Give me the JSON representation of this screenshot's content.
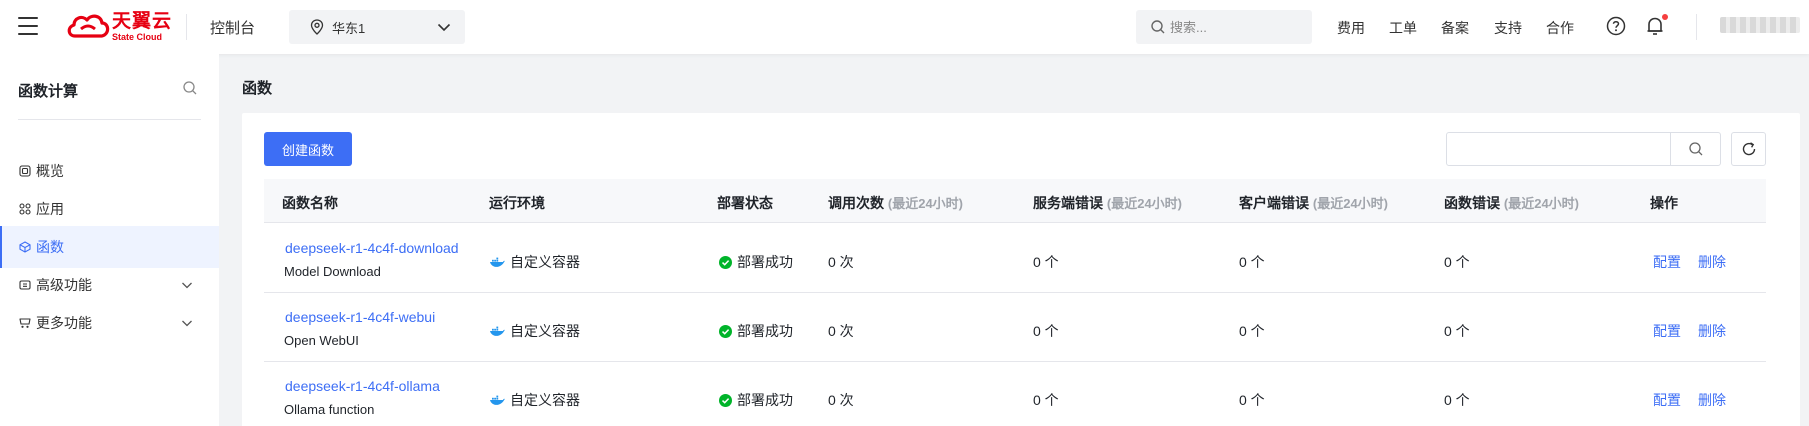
{
  "header": {
    "logo_cn": "天翼云",
    "logo_en": "State Cloud",
    "console": "控制台",
    "region": "华东1",
    "search_placeholder": "搜索...",
    "nav": [
      "费用",
      "工单",
      "备案",
      "支持",
      "合作"
    ],
    "brand_color": "#e60012"
  },
  "sidebar": {
    "title": "函数计算",
    "items": [
      {
        "label": "概览",
        "icon": "overview-icon"
      },
      {
        "label": "应用",
        "icon": "apps-icon"
      },
      {
        "label": "函数",
        "icon": "function-icon",
        "active": true
      },
      {
        "label": "高级功能",
        "icon": "advanced-icon",
        "expandable": true
      },
      {
        "label": "更多功能",
        "icon": "more-icon",
        "expandable": true
      }
    ]
  },
  "main": {
    "title": "函数",
    "create_button": "创建函数",
    "accent_color": "#3d6ef5",
    "columns": [
      {
        "label": "函数名称",
        "sub": ""
      },
      {
        "label": "运行环境",
        "sub": ""
      },
      {
        "label": "部署状态",
        "sub": ""
      },
      {
        "label": "调用次数",
        "sub": "(最近24小时)"
      },
      {
        "label": "服务端错误",
        "sub": "(最近24小时)"
      },
      {
        "label": "客户端错误",
        "sub": "(最近24小时)"
      },
      {
        "label": "函数错误",
        "sub": "(最近24小时)"
      },
      {
        "label": "操作",
        "sub": ""
      }
    ],
    "rows": [
      {
        "name": "deepseek-r1-4c4f-download",
        "desc": "Model Download",
        "runtime": "自定义容器",
        "status": "部署成功",
        "invocations": "0 次",
        "server_errors": "0 个",
        "client_errors": "0 个",
        "function_errors": "0 个",
        "action_config": "配置",
        "action_delete": "删除"
      },
      {
        "name": "deepseek-r1-4c4f-webui",
        "desc": "Open WebUI",
        "runtime": "自定义容器",
        "status": "部署成功",
        "invocations": "0 次",
        "server_errors": "0 个",
        "client_errors": "0 个",
        "function_errors": "0 个",
        "action_config": "配置",
        "action_delete": "删除"
      },
      {
        "name": "deepseek-r1-4c4f-ollama",
        "desc": "Ollama function",
        "runtime": "自定义容器",
        "status": "部署成功",
        "invocations": "0 次",
        "server_errors": "0 个",
        "client_errors": "0 个",
        "function_errors": "0 个",
        "action_config": "配置",
        "action_delete": "删除"
      }
    ]
  }
}
